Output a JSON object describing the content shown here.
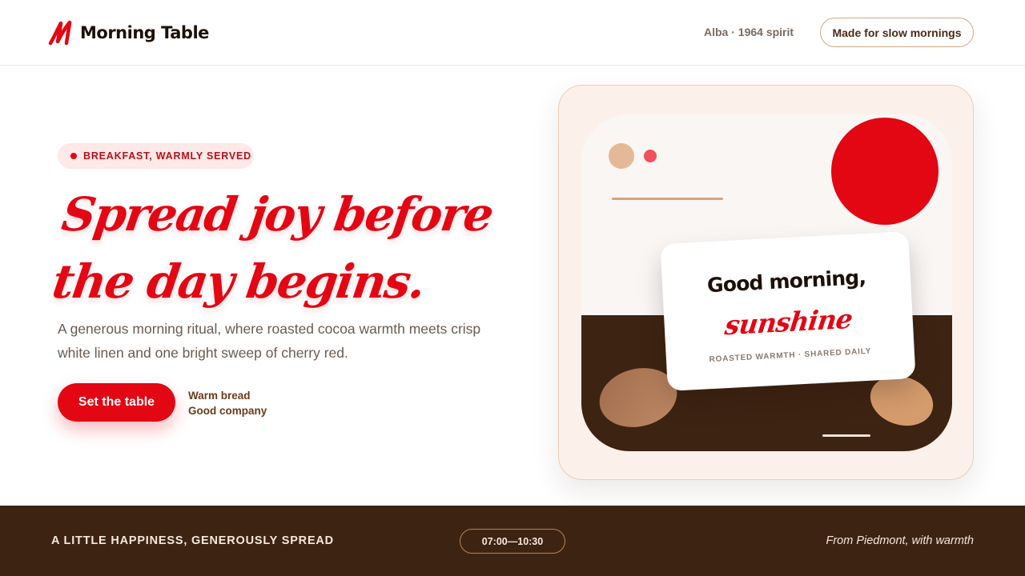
{
  "header": {
    "logo_text": "Morning Table",
    "logo_icon": "script-m-logo",
    "tagline": "Alba · 1964 spirit",
    "pill_label": "Made for slow mornings"
  },
  "hero": {
    "badge": "BREAKFAST, WARMLY SERVED",
    "headline_line1": "Spread joy before",
    "headline_line2": "the day begins.",
    "lead": "A generous morning ritual, where roasted cocoa warmth meets crisp white linen and one bright sweep of cherry red.",
    "cta_label": "Set the table",
    "note_1": "Warm bread",
    "note_2": "Good company"
  },
  "illustration": {
    "card_title": "Good morning,",
    "card_script": "sunshine",
    "card_sub": "ROASTED WARMTH · SHARED DAILY"
  },
  "footer": {
    "left": "A LITTLE HAPPINESS, GENEROUSLY SPREAD",
    "hours": "07:00—10:30",
    "right": "From Piedmont, with warmth"
  },
  "colors": {
    "cherry_red": "#e30613",
    "cocoa_brown": "#3d2312",
    "cream": "#fcf1ea",
    "tan": "#d9a27a"
  }
}
